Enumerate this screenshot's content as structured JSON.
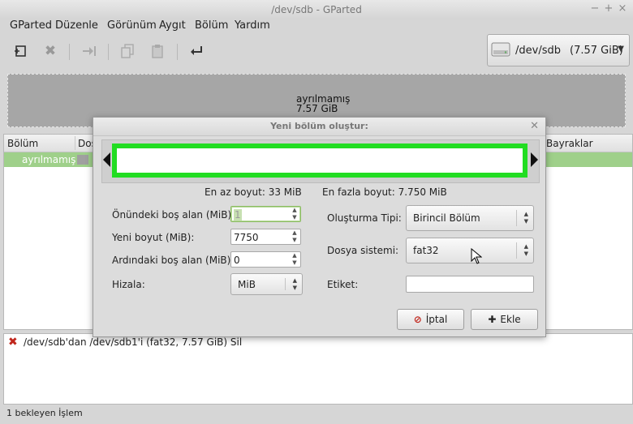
{
  "window": {
    "title": "/dev/sdb - GParted",
    "controls": [
      "−",
      "+",
      "×"
    ]
  },
  "menu": {
    "items": [
      "GParted",
      "Düzenle",
      "Görünüm",
      "Aygıt",
      "Bölüm",
      "Yardım"
    ]
  },
  "device": {
    "name": "/dev/sdb",
    "size": "(7.57 GiB)"
  },
  "map": {
    "label": "ayrılmamış",
    "size": "7.57 GiB"
  },
  "partitions": {
    "columns": [
      "Bölüm",
      "Dos",
      "Bayraklar"
    ],
    "rows": [
      {
        "name": "ayrılmamış"
      }
    ]
  },
  "operations": {
    "items": [
      "/dev/sdb'dan /dev/sdb1'i (fat32, 7.57 GiB) Sil"
    ]
  },
  "status": {
    "text": "1 bekleyen İşlem"
  },
  "dialog": {
    "title": "Yeni bölüm oluştur:",
    "min_size": "En az boyut: 33 MiB",
    "max_size": "En fazla boyut: 7.750 MiB",
    "free_before": {
      "label": "Önündeki boş alan (MiB):",
      "value": "1"
    },
    "new_size": {
      "label": "Yeni boyut (MiB):",
      "value": "7750"
    },
    "free_after": {
      "label": "Ardındaki boş alan (MiB):",
      "value": "0"
    },
    "align": {
      "label": "Hizala:",
      "value": "MiB"
    },
    "create_as": {
      "label": "Oluşturma Tipi:",
      "value": "Birincil Bölüm"
    },
    "filesystem": {
      "label": "Dosya sistemi:",
      "value": "fat32"
    },
    "label_field": {
      "label": "Etiket:",
      "value": ""
    },
    "cancel": "İptal",
    "add": "Ekle"
  },
  "colors": {
    "partition_bar": "#22dd22",
    "unallocated": "#a6a6a6",
    "selected_row": "#9fd08a"
  }
}
